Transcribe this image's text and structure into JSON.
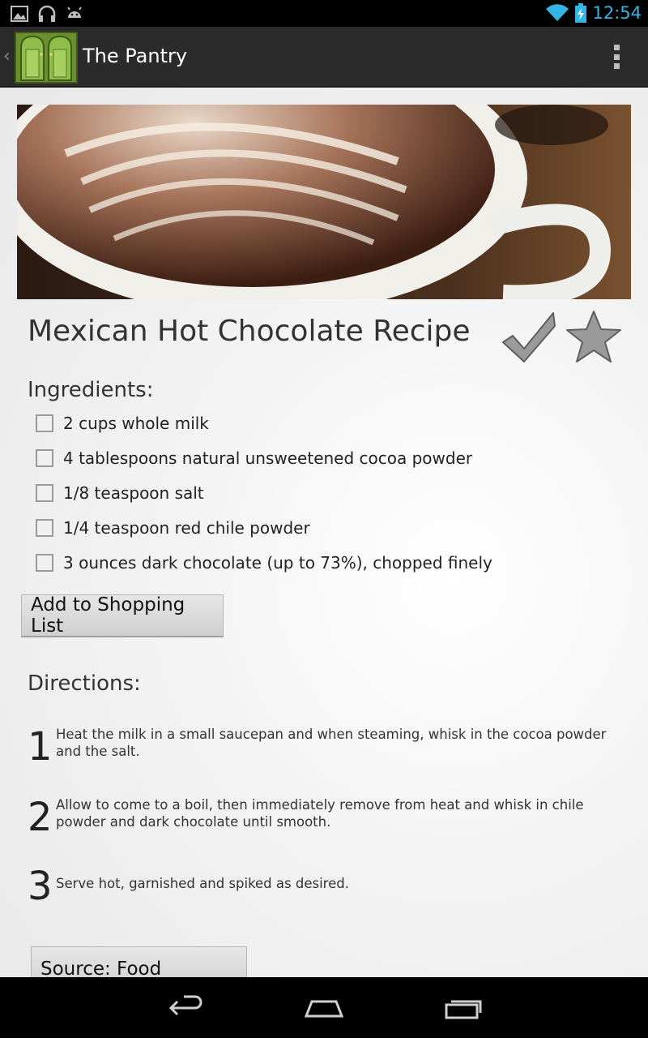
{
  "status_bar": {
    "time": "12:54",
    "left_icons": [
      "image-notification-icon",
      "headphones-icon",
      "android-icon"
    ],
    "right_icons": [
      "wifi-icon",
      "battery-charging-icon"
    ]
  },
  "action_bar": {
    "title": "The Pantry",
    "logo_icon": "pantry-doors-icon"
  },
  "recipe": {
    "title": "Mexican Hot Chocolate Recipe",
    "ingredients_heading": "Ingredients:",
    "ingredients": [
      {
        "label": "2 cups whole milk",
        "checked": false
      },
      {
        "label": "4 tablespoons natural unsweetened cocoa powder",
        "checked": false
      },
      {
        "label": "1/8 teaspoon salt",
        "checked": false
      },
      {
        "label": "1/4 teaspoon red chile powder",
        "checked": false
      },
      {
        "label": "3 ounces dark chocolate (up to 73%), chopped finely",
        "checked": false
      }
    ],
    "add_button": "Add to Shopping List",
    "directions_heading": "Directions:",
    "directions": [
      {
        "num": "1",
        "text": "Heat the milk in a small saucepan and when steaming, whisk in the cocoa powder and the salt."
      },
      {
        "num": "2",
        "text": "Allow to come to a boil, then immediately remove from heat and whisk in chile powder and dark chocolate until smooth."
      },
      {
        "num": "3",
        "text": "Serve hot, garnished and spiked as desired."
      }
    ],
    "source_button": "Source: Food Republic"
  },
  "colors": {
    "accent": "#33b5e5",
    "action_bar": "#2b2b2b"
  }
}
